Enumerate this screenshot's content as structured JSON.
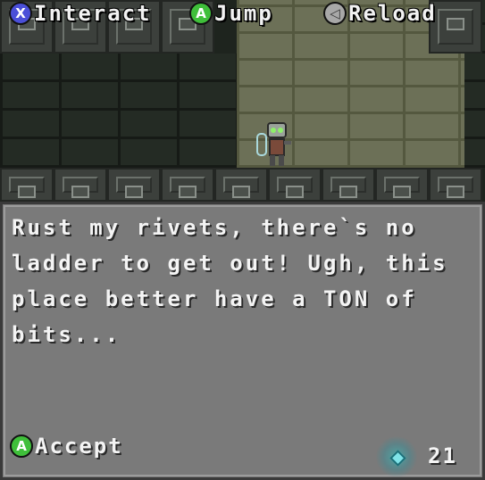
{
  "hud": {
    "prompts": [
      {
        "button": "X",
        "label": "Interact",
        "button_color": "#4a4fd8"
      },
      {
        "button": "A",
        "label": "Jump",
        "button_color": "#3fbf3a"
      },
      {
        "button": "◁",
        "label": "Reload",
        "button_color": "#a8a8a8"
      }
    ]
  },
  "dialog": {
    "text": "Rust my rivets, there`s no\nladder to get out! Ugh, this\nplace better have a TON of\nbits...",
    "accept": {
      "button": "A",
      "label": "Accept",
      "button_color": "#3fbf3a"
    }
  },
  "bits": {
    "count": "21",
    "icon": "bit-gem-icon",
    "color": "#7fe3e8"
  },
  "colors": {
    "dialog_bg": "#7a7a7a",
    "dialog_border": "#3a3a3a"
  }
}
